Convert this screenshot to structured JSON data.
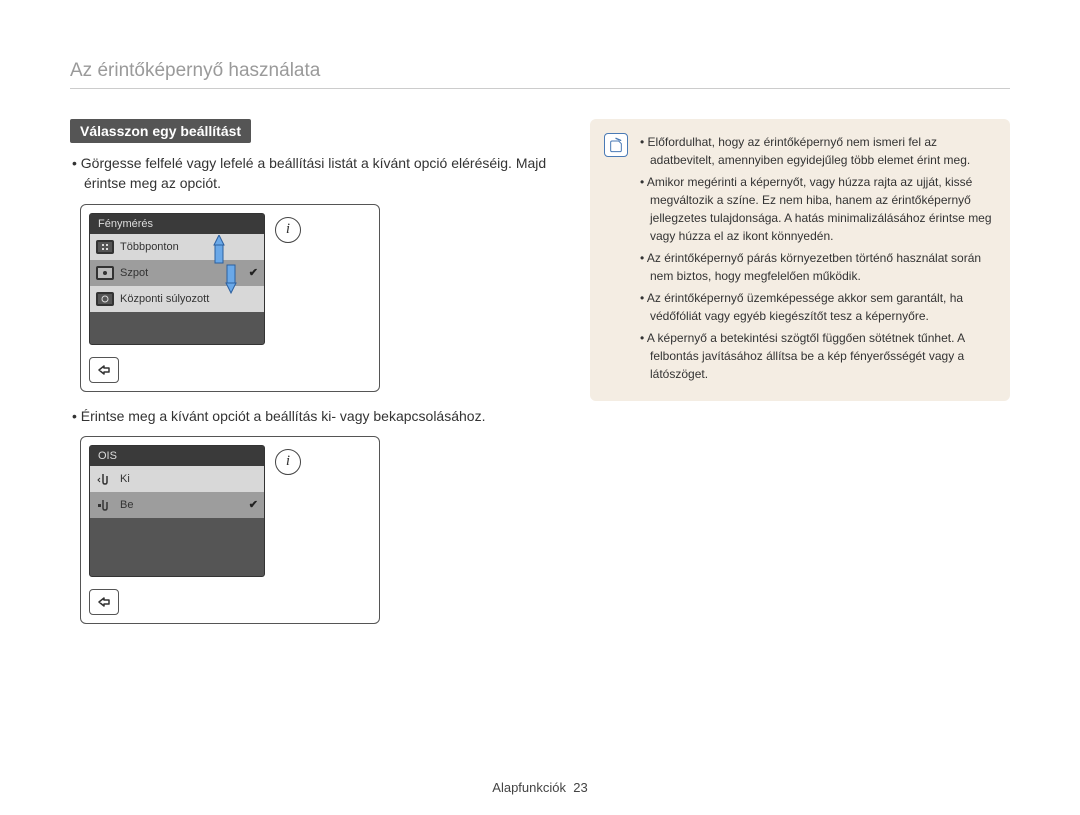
{
  "header": {
    "title": "Az érintőképernyő használata"
  },
  "section": {
    "label": "Válasszon egy beállítást"
  },
  "instructions": {
    "i1": "Görgesse felfelé vagy lefelé a beállítási listát a kívánt opció eléréséig. Majd érintse meg az opciót.",
    "i2": "Érintse meg a kívánt opciót a beállítás ki- vagy bekapcsolásához."
  },
  "device1": {
    "header": "Fénymérés",
    "row1": "Többponton",
    "row2": "Szpot",
    "row3": "Központi súlyozott"
  },
  "device2": {
    "header": "OIS",
    "row1": "Ki",
    "row2": "Be"
  },
  "notes": {
    "n1": "Előfordulhat, hogy az érintőképernyő nem ismeri fel az adatbevitelt, amennyiben egyidejűleg több elemet érint meg.",
    "n2": "Amikor megérinti a képernyőt, vagy húzza rajta az ujját, kissé megváltozik a színe. Ez nem hiba, hanem az érintőképernyő jellegzetes tulajdonsága. A hatás minimalizálásához érintse meg vagy húzza el az ikont könnyedén.",
    "n3": "Az érintőképernyő párás környezetben történő használat során nem biztos, hogy megfelelően működik.",
    "n4": "Az érintőképernyő üzemképessége akkor sem garantált, ha védőfóliát vagy egyéb kiegészítőt tesz a képernyőre.",
    "n5": "A képernyő a betekintési szögtől függően sötétnek tűnhet. A felbontás javításához állítsa be a kép fényerősségét vagy a látószöget."
  },
  "footer": {
    "section": "Alapfunkciók",
    "page": "23"
  },
  "glyphs": {
    "check": "✔",
    "info": "i"
  }
}
